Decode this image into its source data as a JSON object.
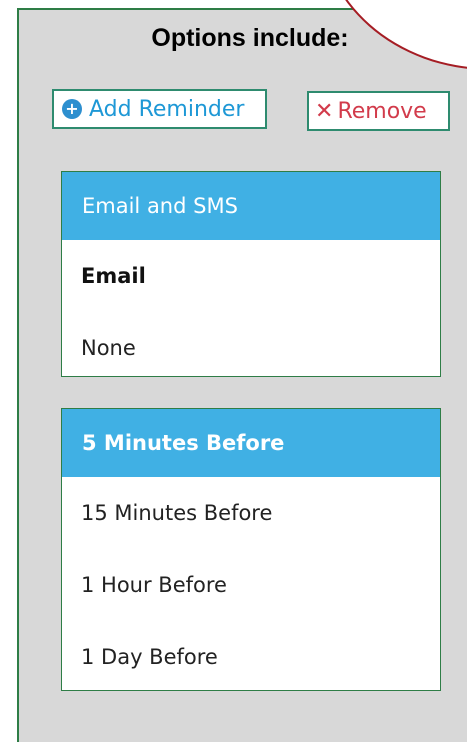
{
  "heading": "Options include:",
  "buttons": {
    "add_label": "Add Reminder",
    "remove_label": "Remove"
  },
  "notification_type": {
    "selected": "Email and SMS",
    "options": [
      "Email",
      "None"
    ]
  },
  "reminder_time": {
    "selected": "5 Minutes Before",
    "options": [
      "15 Minutes Before",
      "1 Hour Before",
      "1 Day Before"
    ]
  },
  "icons": {
    "add": "plus-circle-icon",
    "remove": "x-icon"
  },
  "colors": {
    "panel_bg": "#d8d8d8",
    "panel_border": "#2e7d46",
    "highlight": "#40b0e4",
    "add_text": "#1e98d6",
    "remove_text": "#d23b4b",
    "accent_arc": "#a51d24"
  }
}
